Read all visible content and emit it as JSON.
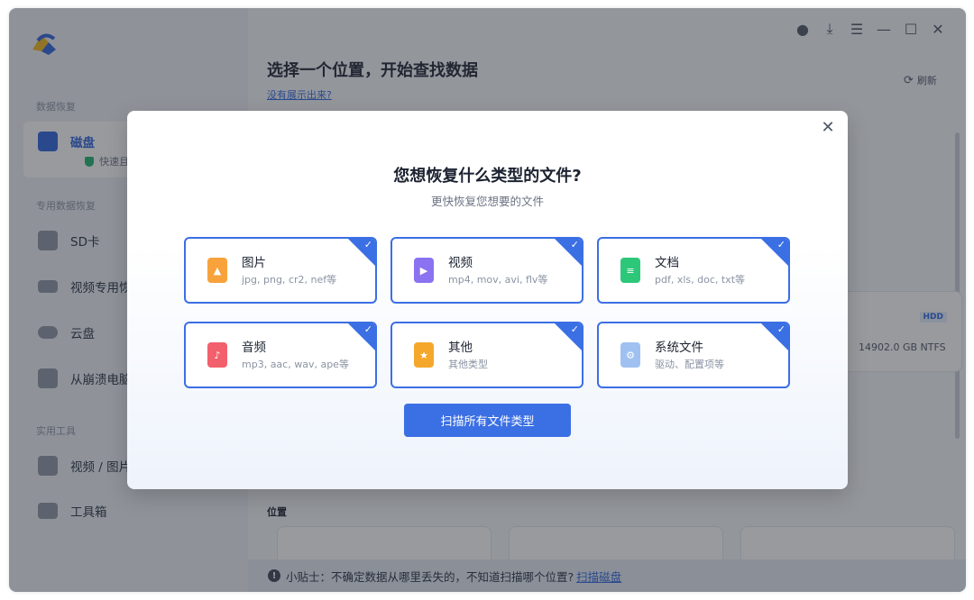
{
  "sidebar": {
    "group_recovery": "数据恢复",
    "disk_item": {
      "label": "磁盘",
      "status": "快速且安"
    },
    "group_special": "专用数据恢复",
    "sd_item": "SD卡",
    "video_item": "视频专用恢",
    "cloud_item": "云盘",
    "crash_item": "从崩溃电脑",
    "group_tools": "实用工具",
    "media_item": "视频 / 图片",
    "toolbox_item": "工具箱"
  },
  "main": {
    "title": "选择一个位置，开始查找数据",
    "help_link": "没有展示出来?",
    "refresh": "刷新",
    "disk": {
      "badge": "HDD",
      "info": "14902.0 GB NTFS"
    },
    "location_label": "位置",
    "tip": {
      "text": "小贴士：不确定数据从哪里丢失的，不知道扫描哪个位置?",
      "link": "扫描磁盘"
    }
  },
  "modal": {
    "title": "您想恢复什么类型的文件?",
    "subtitle": "更快恢复您想要的文件",
    "types": [
      {
        "name": "图片",
        "desc": "jpg, png, cr2, nef等",
        "icon": "image-icon",
        "color": "#f7a23b",
        "checked": true
      },
      {
        "name": "视频",
        "desc": "mp4, mov, avi, flv等",
        "icon": "video-icon",
        "color": "#8b72f0",
        "checked": true
      },
      {
        "name": "文档",
        "desc": "pdf, xls, doc, txt等",
        "icon": "document-icon",
        "color": "#2dc77a",
        "checked": true
      },
      {
        "name": "音频",
        "desc": "mp3, aac, wav, ape等",
        "icon": "audio-icon",
        "color": "#f2606d",
        "checked": true
      },
      {
        "name": "其他",
        "desc": "其他类型",
        "icon": "other-file-icon",
        "color": "#f5a72c",
        "checked": true
      },
      {
        "name": "系统文件",
        "desc": "驱动、配置项等",
        "icon": "system-file-icon",
        "color": "#9fc1f2",
        "checked": true
      }
    ],
    "scan_button": "扫描所有文件类型"
  },
  "colors": {
    "accent": "#3b6fe4",
    "link": "#2f67e0"
  }
}
